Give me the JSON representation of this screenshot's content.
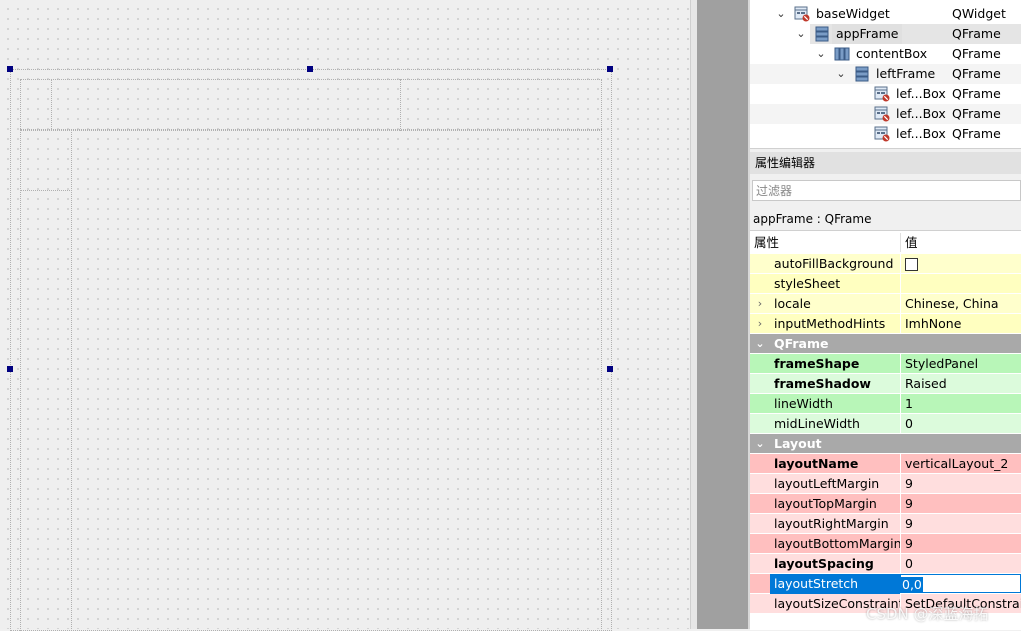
{
  "object_tree": [
    {
      "name": "baseWidget",
      "class": "QWidget",
      "icon": "widget-icon",
      "arrow": "expanded"
    },
    {
      "name": "appFrame",
      "class": "QFrame",
      "icon": "vertical-layout-icon",
      "arrow": "expanded",
      "selected": true
    },
    {
      "name": "contentBox",
      "class": "QFrame",
      "icon": "horizontal-layout-icon",
      "arrow": "expanded"
    },
    {
      "name": "leftFrame",
      "class": "QFrame",
      "icon": "vertical-layout-icon",
      "arrow": "expanded"
    },
    {
      "name": "lef...Box",
      "class": "QFrame",
      "icon": "widget-icon"
    },
    {
      "name": "lef...Box",
      "class": "QFrame",
      "icon": "widget-icon"
    },
    {
      "name": "lef...Box",
      "class": "QFrame",
      "icon": "widget-icon"
    }
  ],
  "property_editor": {
    "title": "属性编辑器",
    "filter_placeholder": "过滤器",
    "object_label": "appFrame : QFrame",
    "header": {
      "name": "属性",
      "value": "值"
    },
    "rows": [
      {
        "name": "autoFillBackground",
        "value": "",
        "checkbox": true
      },
      {
        "name": "styleSheet",
        "value": ""
      },
      {
        "name": "locale",
        "value": "Chinese, China",
        "expandable": true
      },
      {
        "name": "inputMethodHints",
        "value": "ImhNone",
        "expandable": true
      },
      {
        "section": "QFrame"
      },
      {
        "name": "frameShape",
        "value": "StyledPanel",
        "bold": true
      },
      {
        "name": "frameShadow",
        "value": "Raised",
        "bold": true
      },
      {
        "name": "lineWidth",
        "value": "1"
      },
      {
        "name": "midLineWidth",
        "value": "0"
      },
      {
        "section": "Layout"
      },
      {
        "name": "layoutName",
        "value": "verticalLayout_2",
        "bold": true
      },
      {
        "name": "layoutLeftMargin",
        "value": "9"
      },
      {
        "name": "layoutTopMargin",
        "value": "9"
      },
      {
        "name": "layoutRightMargin",
        "value": "9"
      },
      {
        "name": "layoutBottomMargin",
        "value": "9"
      },
      {
        "name": "layoutSpacing",
        "value": "0",
        "bold": true
      },
      {
        "name": "layoutStretch",
        "value": "0,0",
        "editing": true
      },
      {
        "name": "layoutSizeConstraint",
        "value": "SetDefaultConstraint"
      }
    ]
  },
  "watermark": "CSDN @深蓝海拓",
  "colors": {
    "selection": "#0078d7",
    "section": "#a9a9a9",
    "qobject_rows": [
      "#ffffcc",
      "#ffffc0"
    ],
    "qframe_rows": [
      "#b8f6b8",
      "#dcfbdc"
    ],
    "layout_rows": [
      "#ffbfbf",
      "#ffdede"
    ],
    "handle": "#000080"
  }
}
